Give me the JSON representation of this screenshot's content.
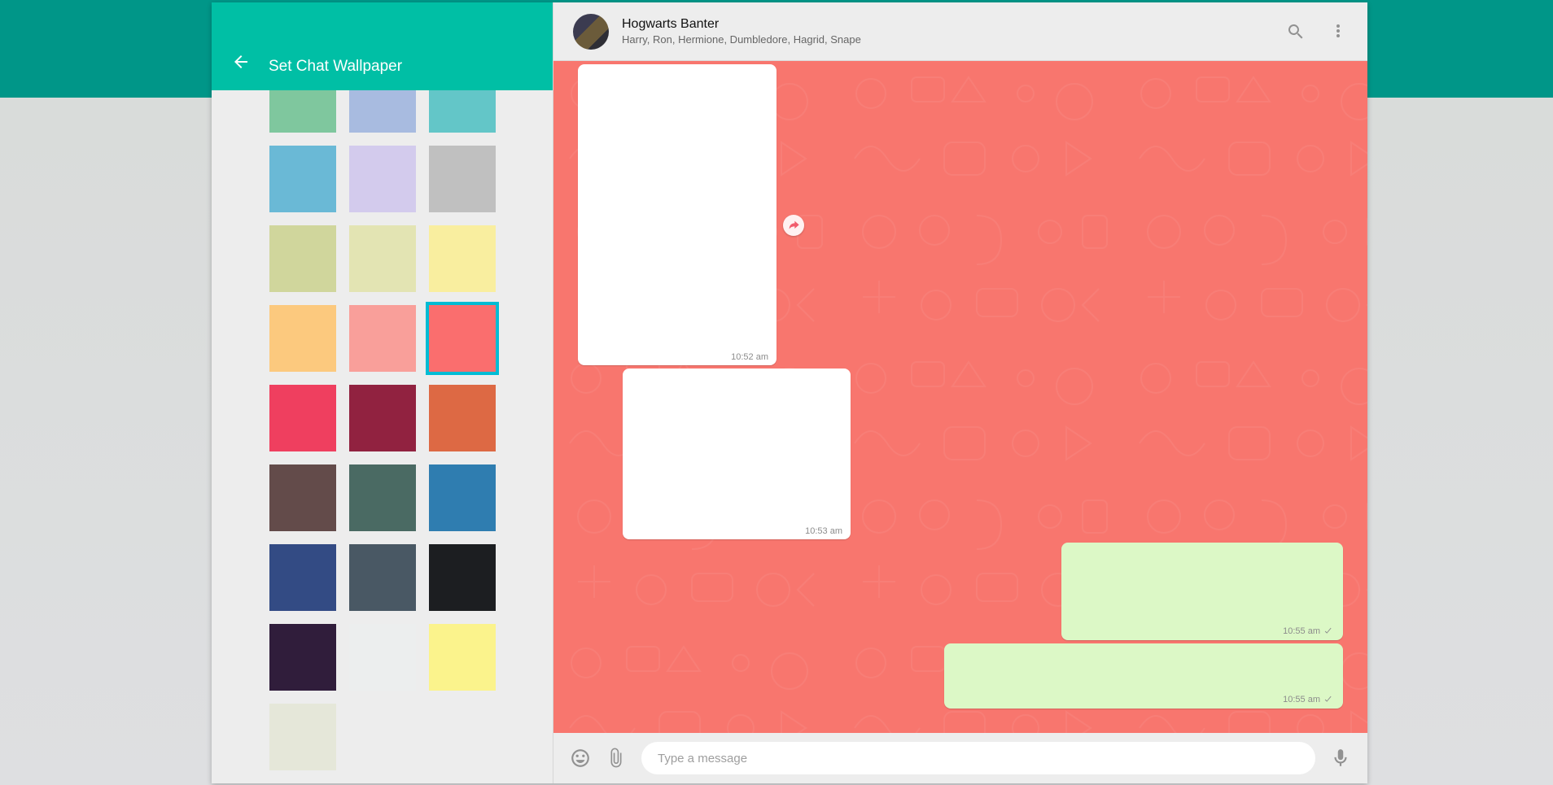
{
  "panel": {
    "title": "Set Chat Wallpaper",
    "selected_index": 11,
    "swatches": [
      "#7fc79e",
      "#a8bbe0",
      "#63c6c8",
      "#6ab9d6",
      "#d3cbed",
      "#c0c0c0",
      "#d0d69c",
      "#e3e4b3",
      "#f9ee9f",
      "#fcc97e",
      "#f99f9a",
      "#fa6e6e",
      "#ef3f5f",
      "#912240",
      "#dd6944",
      "#634b4a",
      "#4a6a63",
      "#2f7db0",
      "#334b84",
      "#495864",
      "#1c1e21",
      "#301d3b",
      "#eceeee",
      "#fbf38c",
      "#e5e7d9"
    ]
  },
  "chat": {
    "name": "Hogwarts Banter",
    "members": "Harry, Ron, Hermione, Dumbledore, Hagrid, Snape",
    "wallpaper_color": "#f8766e",
    "messages": [
      {
        "id": "m1",
        "dir": "in",
        "time": "10:52 am",
        "tick": false,
        "forward": true
      },
      {
        "id": "m2",
        "dir": "in",
        "time": "10:53 am",
        "tick": false,
        "forward": false
      },
      {
        "id": "m3",
        "dir": "out",
        "time": "10:55 am",
        "tick": true,
        "forward": false
      },
      {
        "id": "m4",
        "dir": "out",
        "time": "10:55 am",
        "tick": true,
        "forward": false
      }
    ]
  },
  "composer": {
    "placeholder": "Type a message"
  }
}
